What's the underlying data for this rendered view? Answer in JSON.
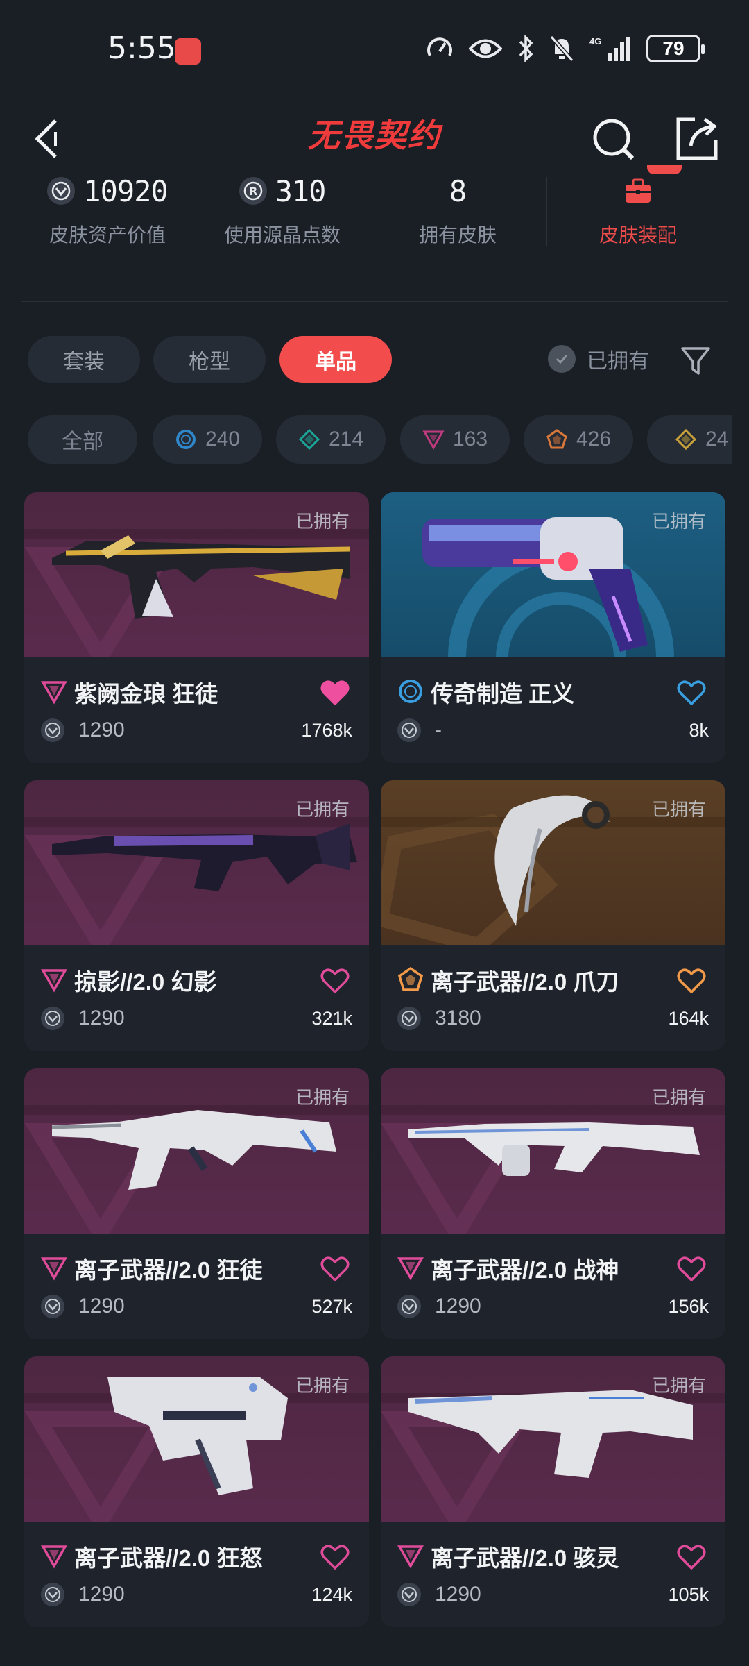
{
  "status_bar": {
    "time": "5:55",
    "battery": "79",
    "network": "4G"
  },
  "header": {
    "title": "无畏契约"
  },
  "stats": [
    {
      "value": "10920",
      "label": "皮肤资产价值",
      "icon": "vp-icon"
    },
    {
      "value": "310",
      "label": "使用源晶点数",
      "icon": "radianite-icon"
    },
    {
      "value": "8",
      "label": "拥有皮肤",
      "icon": ""
    }
  ],
  "loadout": {
    "label": "皮肤装配",
    "icon": "briefcase-icon"
  },
  "tabs": [
    {
      "label": "套装",
      "active": false
    },
    {
      "label": "枪型",
      "active": false
    },
    {
      "label": "单品",
      "active": true
    }
  ],
  "owned_filter": {
    "label": "已拥有"
  },
  "rarity_chips": [
    {
      "label": "全部",
      "icon": ""
    },
    {
      "label": "240",
      "icon": "ultra-circle-icon",
      "color": "#2f86c8"
    },
    {
      "label": "214",
      "icon": "diamond-icon",
      "color": "#1aa598"
    },
    {
      "label": "163",
      "icon": "triangle-icon",
      "color": "#c03a7f"
    },
    {
      "label": "426",
      "icon": "pentagon-icon",
      "color": "#d7783a"
    },
    {
      "label": "24",
      "icon": "diamond-gold-icon",
      "color": "#c8a13a"
    }
  ],
  "skins": [
    {
      "name": "紫阙金琅 狂徒",
      "price": "1290",
      "likes": "1768k",
      "owned": "已拥有",
      "rarity": "triangle",
      "rarity_color": "#e04b9a",
      "liked": true,
      "heart_color": "#ee4f9e",
      "bg": "purple"
    },
    {
      "name": "传奇制造 正义",
      "price": "-",
      "likes": "8k",
      "owned": "已拥有",
      "rarity": "circle",
      "rarity_color": "#3a9fe0",
      "liked": false,
      "heart_color": "#3a9fe0",
      "bg": "blue"
    },
    {
      "name": "掠影//2.0 幻影",
      "price": "1290",
      "likes": "321k",
      "owned": "已拥有",
      "rarity": "triangle",
      "rarity_color": "#e04b9a",
      "liked": false,
      "heart_color": "#e04b9a",
      "bg": "purple"
    },
    {
      "name": "离子武器//2.0 爪刀",
      "price": "3180",
      "likes": "164k",
      "owned": "已拥有",
      "rarity": "pentagon",
      "rarity_color": "#f29a4a",
      "liked": false,
      "heart_color": "#f29a4a",
      "bg": "orange"
    },
    {
      "name": "离子武器//2.0 狂徒",
      "price": "1290",
      "likes": "527k",
      "owned": "已拥有",
      "rarity": "triangle",
      "rarity_color": "#e04b9a",
      "liked": false,
      "heart_color": "#e04b9a",
      "bg": "purple"
    },
    {
      "name": "离子武器//2.0 战神",
      "price": "1290",
      "likes": "156k",
      "owned": "已拥有",
      "rarity": "triangle",
      "rarity_color": "#e04b9a",
      "liked": false,
      "heart_color": "#e04b9a",
      "bg": "purple"
    },
    {
      "name": "离子武器//2.0 狂怒",
      "price": "1290",
      "likes": "124k",
      "owned": "已拥有",
      "rarity": "triangle",
      "rarity_color": "#e04b9a",
      "liked": false,
      "heart_color": "#e04b9a",
      "bg": "purple"
    },
    {
      "name": "离子武器//2.0 骇灵",
      "price": "1290",
      "likes": "105k",
      "owned": "已拥有",
      "rarity": "triangle",
      "rarity_color": "#e04b9a",
      "liked": false,
      "heart_color": "#e04b9a",
      "bg": "purple"
    }
  ]
}
